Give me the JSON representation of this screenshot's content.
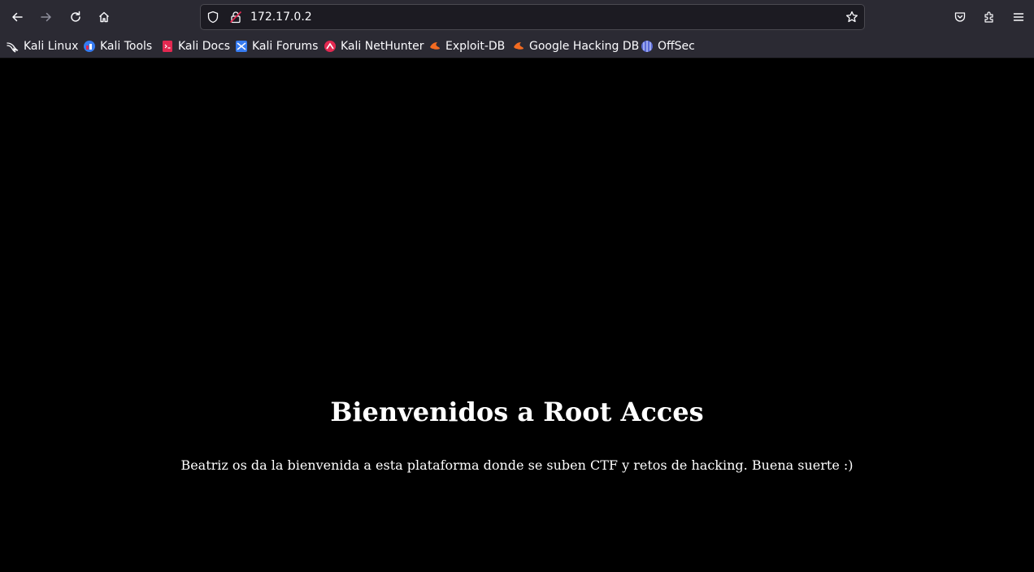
{
  "browser": {
    "url": "172.17.0.2",
    "colors": {
      "toolbar": "#2b2a33",
      "urlbar": "#1c1b22",
      "text": "#fbfbfe",
      "page_bg": "#000000"
    }
  },
  "bookmarks": [
    {
      "label": "Kali Linux",
      "icon": "kali-dragon-icon"
    },
    {
      "label": "Kali Tools",
      "icon": "kali-tools-icon"
    },
    {
      "label": "Kali Docs",
      "icon": "kali-docs-icon"
    },
    {
      "label": "Kali Forums",
      "icon": "kali-forums-icon"
    },
    {
      "label": "Kali NetHunter",
      "icon": "kali-nethunter-icon"
    },
    {
      "label": "Exploit-DB",
      "icon": "exploit-db-icon"
    },
    {
      "label": "Google Hacking DB",
      "icon": "ghdb-icon"
    },
    {
      "label": "OffSec",
      "icon": "offsec-icon"
    }
  ],
  "page": {
    "heading": "Bienvenidos a Root Acces",
    "message": "Beatriz os da la bienvenida a esta plataforma donde se suben CTF y retos de hacking. Buena suerte :)"
  }
}
